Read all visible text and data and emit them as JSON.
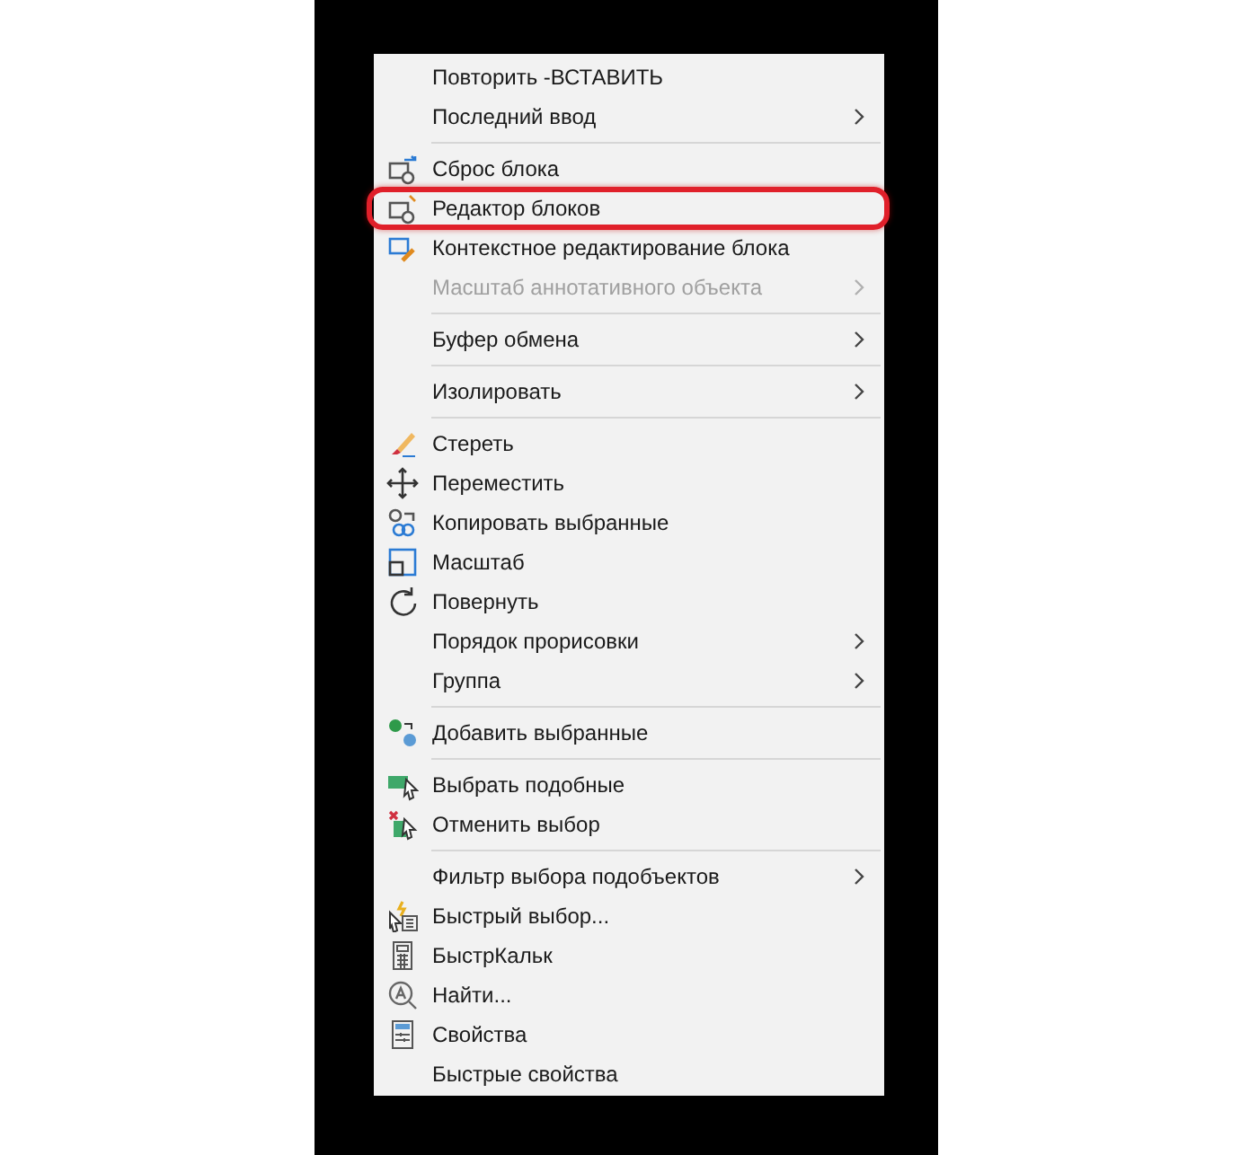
{
  "context_menu": {
    "groups": [
      {
        "items": [
          {
            "label": "Повторить -ВСТАВИТЬ",
            "submenu": false,
            "disabled": false,
            "highlighted": false
          },
          {
            "label": "Последний ввод",
            "submenu": true,
            "disabled": false,
            "highlighted": false
          }
        ]
      },
      {
        "items": [
          {
            "label": "Сброс блока",
            "submenu": false,
            "disabled": false,
            "highlighted": false
          },
          {
            "label": "Редактор блоков",
            "submenu": false,
            "disabled": false,
            "highlighted": true
          },
          {
            "label": "Контекстное редактирование блока",
            "submenu": false,
            "disabled": false,
            "highlighted": false
          },
          {
            "label": "Масштаб аннотативного объекта",
            "submenu": true,
            "disabled": true,
            "highlighted": false
          }
        ]
      },
      {
        "items": [
          {
            "label": "Буфер обмена",
            "submenu": true,
            "disabled": false,
            "highlighted": false
          }
        ]
      },
      {
        "items": [
          {
            "label": "Изолировать",
            "submenu": true,
            "disabled": false,
            "highlighted": false
          }
        ]
      },
      {
        "items": [
          {
            "label": "Стереть",
            "submenu": false,
            "disabled": false,
            "highlighted": false
          },
          {
            "label": "Переместить",
            "submenu": false,
            "disabled": false,
            "highlighted": false
          },
          {
            "label": "Копировать выбранные",
            "submenu": false,
            "disabled": false,
            "highlighted": false
          },
          {
            "label": "Масштаб",
            "submenu": false,
            "disabled": false,
            "highlighted": false
          },
          {
            "label": "Повернуть",
            "submenu": false,
            "disabled": false,
            "highlighted": false
          },
          {
            "label": "Порядок прорисовки",
            "submenu": true,
            "disabled": false,
            "highlighted": false
          },
          {
            "label": "Группа",
            "submenu": true,
            "disabled": false,
            "highlighted": false
          }
        ]
      },
      {
        "items": [
          {
            "label": "Добавить выбранные",
            "submenu": false,
            "disabled": false,
            "highlighted": false
          }
        ]
      },
      {
        "items": [
          {
            "label": "Выбрать подобные",
            "submenu": false,
            "disabled": false,
            "highlighted": false
          },
          {
            "label": "Отменить выбор",
            "submenu": false,
            "disabled": false,
            "highlighted": false
          }
        ]
      },
      {
        "items": [
          {
            "label": "Фильтр выбора подобъектов",
            "submenu": true,
            "disabled": false,
            "highlighted": false
          },
          {
            "label": "Быстрый выбор...",
            "submenu": false,
            "disabled": false,
            "highlighted": false
          },
          {
            "label": "БыстрКальк",
            "submenu": false,
            "disabled": false,
            "highlighted": false
          },
          {
            "label": "Найти...",
            "submenu": false,
            "disabled": false,
            "highlighted": false
          },
          {
            "label": "Свойства",
            "submenu": false,
            "disabled": false,
            "highlighted": false
          },
          {
            "label": "Быстрые свойства",
            "submenu": false,
            "disabled": false,
            "highlighted": false
          }
        ]
      }
    ]
  }
}
